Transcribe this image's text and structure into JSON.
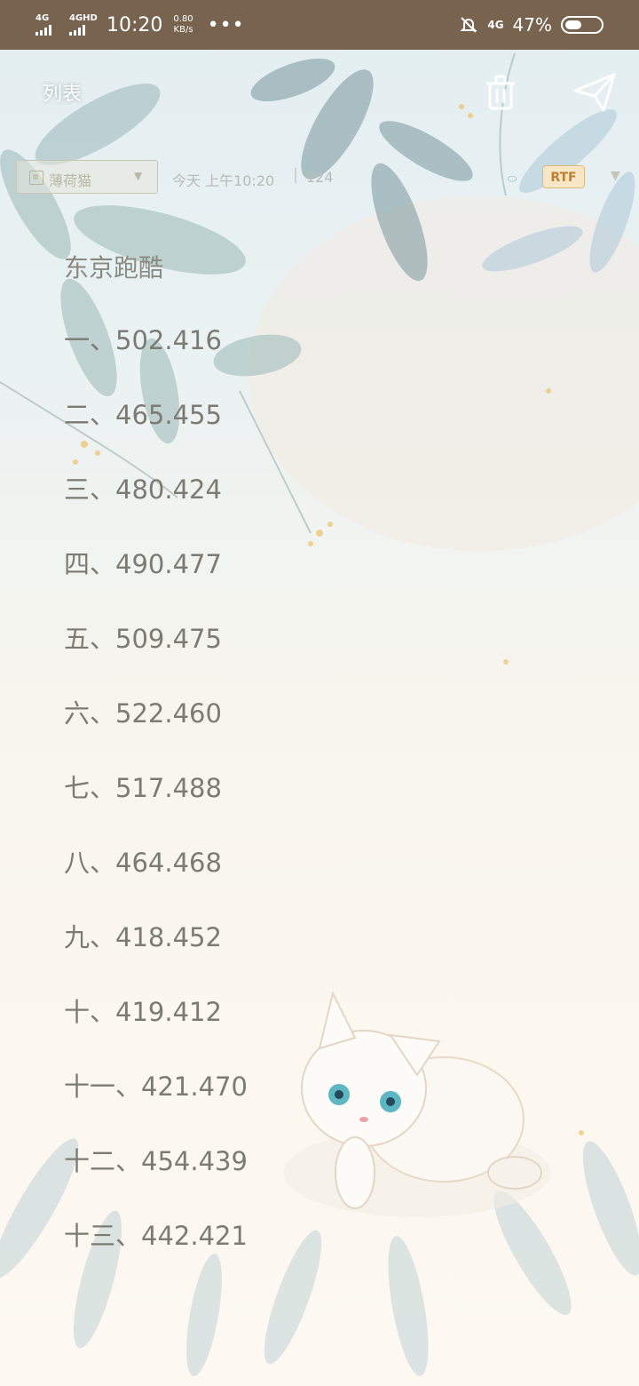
{
  "status_bar": {
    "signal1_label": "4G",
    "signal2_label": "4GHD",
    "time": "10:20",
    "speed_value": "0.80",
    "speed_unit": "KB/s",
    "more": "•••",
    "network_right": "4G",
    "battery_percent": "47%",
    "battery_level": 0.47
  },
  "header": {
    "title": "列表",
    "delete_icon": "trash-icon",
    "send_icon": "paper-plane-icon"
  },
  "meta": {
    "folder": "薄荷猫",
    "date": "今天 上午10:20",
    "separator": "|",
    "char_count": "124",
    "format_badge": "RTF"
  },
  "note": {
    "title": "东京跑酷",
    "entries": [
      "一、502.416",
      "二、465.455",
      "三、480.424",
      "四、490.477",
      "五、509.475",
      "六、522.460",
      "七、517.488",
      "八、464.468",
      "九、418.452",
      "十、419.412",
      "十一、421.470",
      "十二、454.439",
      "十三、442.421"
    ]
  },
  "colors": {
    "status_bar": "#78634f",
    "text": "#7c7b73",
    "rtf_badge": "#c17d30"
  }
}
